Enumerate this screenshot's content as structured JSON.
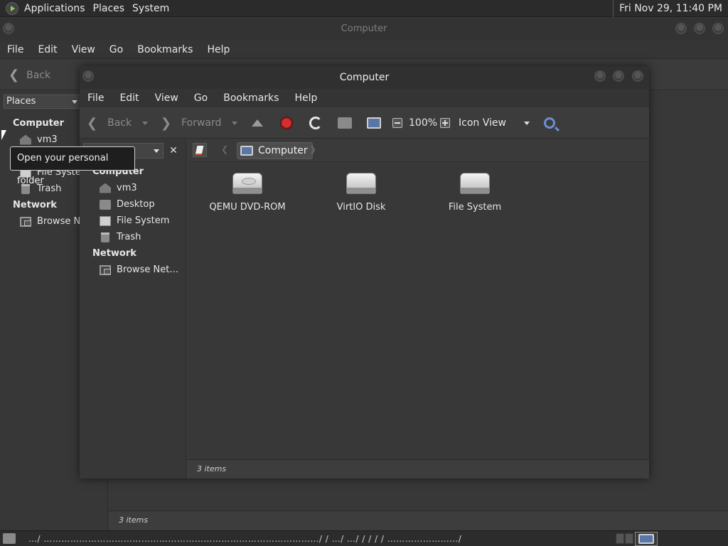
{
  "top_panel": {
    "menus": [
      "Applications",
      "Places",
      "System"
    ],
    "clock": "Fri Nov 29, 11:40 PM"
  },
  "bg_window": {
    "title": "Computer",
    "menus": [
      "File",
      "Edit",
      "View",
      "Go",
      "Bookmarks",
      "Help"
    ],
    "back_label": "Back",
    "places_combo": "Places",
    "sidebar": {
      "computer_heading": "Computer",
      "items": [
        "vm3",
        "File System",
        "Trash"
      ],
      "network_heading": "Network",
      "network_items": [
        "Browse Ne"
      ]
    },
    "status": "3 items"
  },
  "tooltip": "Open your personal folder",
  "front_window": {
    "title": "Computer",
    "menus": [
      "File",
      "Edit",
      "View",
      "Go",
      "Bookmarks",
      "Help"
    ],
    "toolbar": {
      "back": "Back",
      "forward": "Forward",
      "zoom": "100%",
      "view_mode": "Icon View"
    },
    "sidebar": {
      "computer_heading": "Computer",
      "items": [
        "vm3",
        "Desktop",
        "File System",
        "Trash"
      ],
      "network_heading": "Network",
      "network_items": [
        "Browse Net…"
      ]
    },
    "path_current": "Computer",
    "drives": [
      "QEMU DVD-ROM",
      "VirtIO Disk",
      "File System"
    ],
    "status": "3 items"
  },
  "bottom_panel": {
    "task_text": "…/ …………………………………………………………………………………/ / …/ …/ / / / / ……………………/"
  },
  "colors": {
    "panel": "#2b2b2b",
    "window_bg": "#3a3a3a",
    "stop": "#d23030",
    "search": "#6b8fd0"
  }
}
